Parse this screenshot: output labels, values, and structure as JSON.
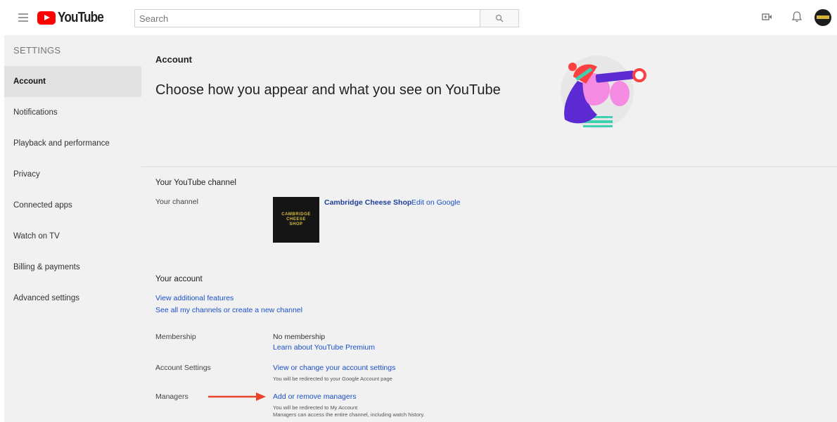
{
  "header": {
    "logo_text": "YouTube",
    "search_placeholder": "Search",
    "icons": [
      "menu-icon",
      "search-icon",
      "video-camera-icon",
      "bell-icon",
      "avatar"
    ]
  },
  "sidebar": {
    "title": "SETTINGS",
    "items": [
      {
        "label": "Account",
        "active": true
      },
      {
        "label": "Notifications",
        "active": false
      },
      {
        "label": "Playback and performance",
        "active": false
      },
      {
        "label": "Privacy",
        "active": false
      },
      {
        "label": "Connected apps",
        "active": false
      },
      {
        "label": "Watch on TV",
        "active": false
      },
      {
        "label": "Billing & payments",
        "active": false
      },
      {
        "label": "Advanced settings",
        "active": false
      }
    ]
  },
  "main": {
    "section_title": "Account",
    "headline": "Choose how you appear and what you see on YouTube",
    "channel": {
      "heading": "Your YouTube channel",
      "label": "Your channel",
      "thumbnail_text": "CAMBRIDGE CHEESE SHOP",
      "name": "Cambridge Cheese Shop",
      "edit_link": "Edit on Google"
    },
    "account": {
      "heading": "Your account",
      "link_features": "View additional features",
      "link_channels": "See all my channels or create a new channel",
      "membership_label": "Membership",
      "membership_value": "No membership",
      "membership_link": "Learn about YouTube Premium",
      "settings_label": "Account Settings",
      "settings_link": "View or change your account settings",
      "settings_note": "You will be redirected to your Google Account page",
      "managers_label": "Managers",
      "managers_link": "Add or remove managers",
      "managers_note1": "You will be redirected to My Account",
      "managers_note2": "Managers can access the entire channel, including watch history."
    }
  },
  "colors": {
    "brand_red": "#ff0000",
    "link_blue": "#1a4fc8",
    "arrow_red": "#e8432b",
    "sidebar_bg": "#f1f1f1",
    "active_item_bg": "#e2e2e2"
  }
}
